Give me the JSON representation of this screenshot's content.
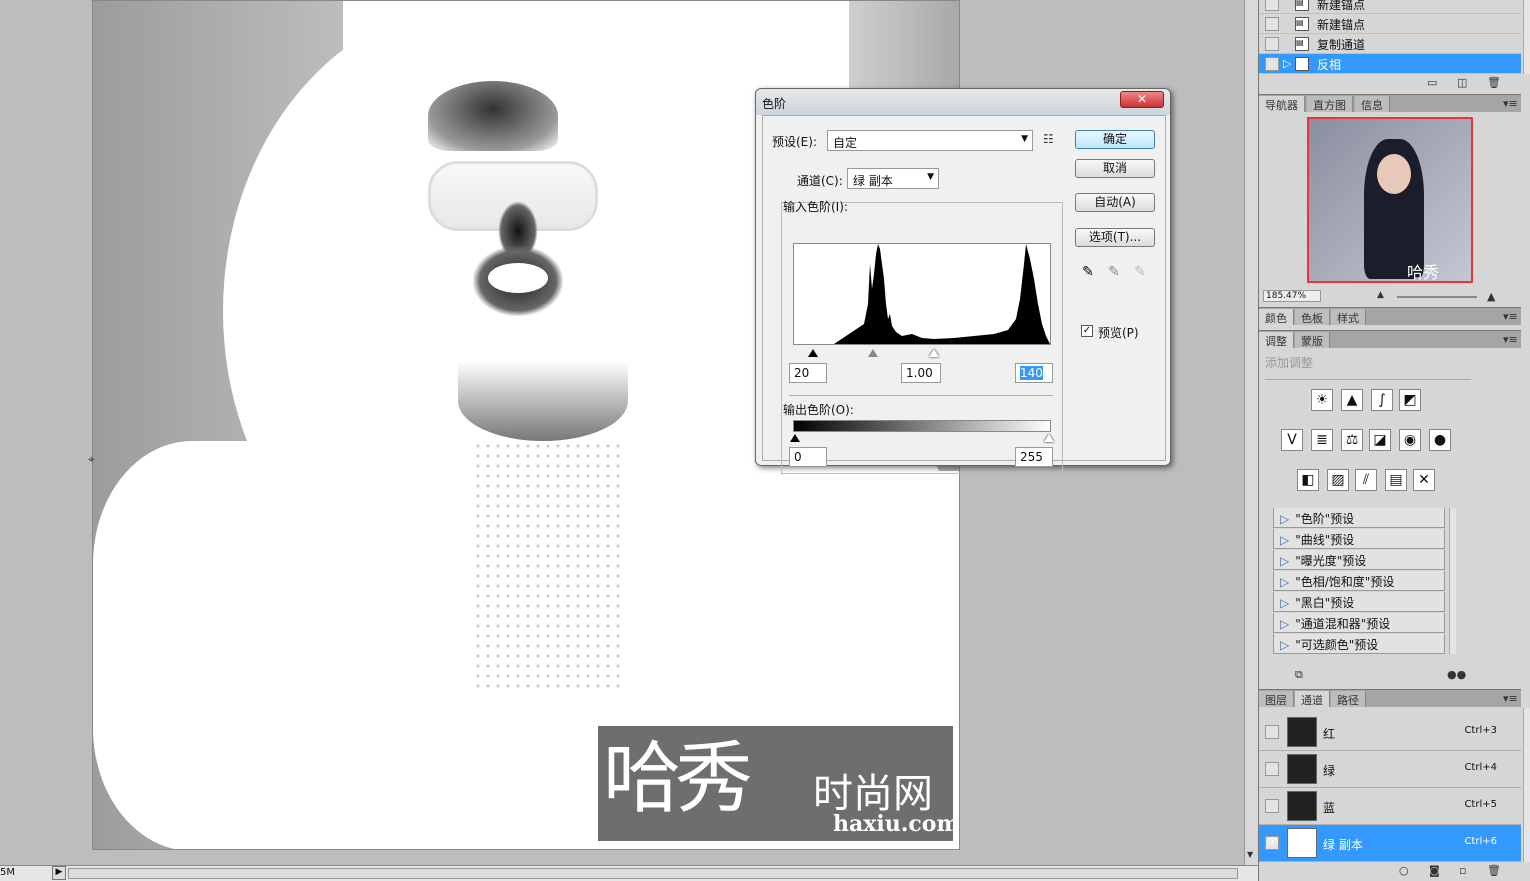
{
  "statusbar": {
    "zoom": "5M"
  },
  "watermark": {
    "brand": "哈秀",
    "suffix": "时尚网",
    "url": "haxiu.com"
  },
  "dialog": {
    "title": "色阶",
    "close": "✕",
    "preset_label": "预设(E):",
    "preset_value": "自定",
    "channel_label": "通道(C):",
    "channel_value": "绿 副本",
    "input_label": "输入色阶(I):",
    "input_black": "20",
    "input_gamma": "1.00",
    "input_white": "140",
    "output_label": "输出色阶(O):",
    "output_black": "0",
    "output_white": "255",
    "ok": "确定",
    "cancel": "取消",
    "auto": "自动(A)",
    "options": "选项(T)...",
    "preview_label": "预览(P)",
    "preview_checked": true
  },
  "history": {
    "items": [
      {
        "label": "新建锚点",
        "active": false
      },
      {
        "label": "新建锚点",
        "active": false
      },
      {
        "label": "复制通道",
        "active": false
      },
      {
        "label": "反相",
        "active": true
      }
    ]
  },
  "navigator": {
    "tabs": [
      "导航器",
      "直方图",
      "信息"
    ],
    "zoom": "185.47%",
    "thumb_caption": "哈秀"
  },
  "color_tabs": [
    "颜色",
    "色板",
    "样式"
  ],
  "adjust": {
    "tabs": [
      "调整",
      "蒙版"
    ],
    "hint": "添加调整",
    "presets": [
      "\"色阶\"预设",
      "\"曲线\"预设",
      "\"曝光度\"预设",
      "\"色相/饱和度\"预设",
      "\"黑白\"预设",
      "\"通道混和器\"预设",
      "\"可选颜色\"预设"
    ]
  },
  "layers": {
    "tabs": [
      "图层",
      "通道",
      "路径"
    ],
    "channels": [
      {
        "name": "红",
        "key": "Ctrl+3",
        "active": false
      },
      {
        "name": "绿",
        "key": "Ctrl+4",
        "active": false
      },
      {
        "name": "蓝",
        "key": "Ctrl+5",
        "active": false
      },
      {
        "name": "绿 副本",
        "key": "Ctrl+6",
        "active": true
      }
    ]
  }
}
